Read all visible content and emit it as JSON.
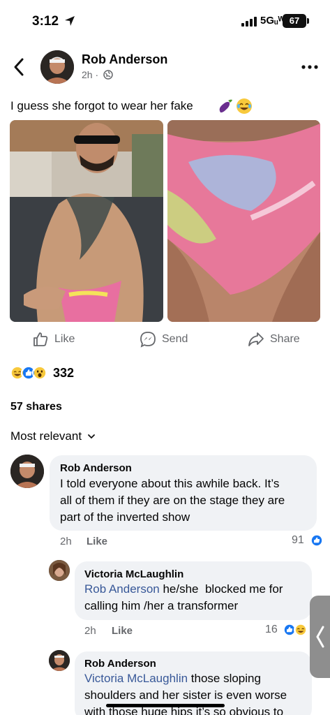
{
  "status_bar": {
    "time": "3:12",
    "network": "5Gᵤᵂ",
    "battery": "67"
  },
  "post": {
    "author": "Rob Anderson",
    "time": "2h",
    "separator": "·",
    "text": "I guess she forgot to wear her fake",
    "actions": {
      "like": "Like",
      "send": "Send",
      "share": "Share"
    },
    "reaction_count": "332",
    "shares": "57 shares"
  },
  "comments_sort": "Most relevant",
  "comments": [
    {
      "author": "Rob Anderson",
      "text_lines": [
        "I told everyone about this awhile back. It’s",
        "all of them if they are on the stage they are",
        "part of the inverted show"
      ],
      "time": "2h",
      "like_label": "Like",
      "reaction_count": "91"
    },
    {
      "author": "Victoria McLaughlin",
      "mention": "Rob Anderson",
      "text_line1_rest": " he/she  blocked me for",
      "text_line2": "calling him /her a transformer",
      "time": "2h",
      "like_label": "Like",
      "reaction_count": "16"
    },
    {
      "author": "Rob Anderson",
      "mention": "Victoria McLaughlin",
      "text_line1_rest": " those sloping",
      "text_line2": "shoulders and her sister is even worse",
      "text_line3": "with those huge hips it’s so obvious to"
    }
  ],
  "colors": {
    "accent": "#1877f2",
    "mention": "#385898",
    "muted": "#65676b",
    "bubble": "#f0f2f5"
  },
  "icons": [
    "back-icon",
    "globe-icon",
    "more-icon",
    "like-icon",
    "messenger-icon",
    "share-icon",
    "eggplant-icon",
    "joy-icon",
    "chevron-down-icon"
  ]
}
